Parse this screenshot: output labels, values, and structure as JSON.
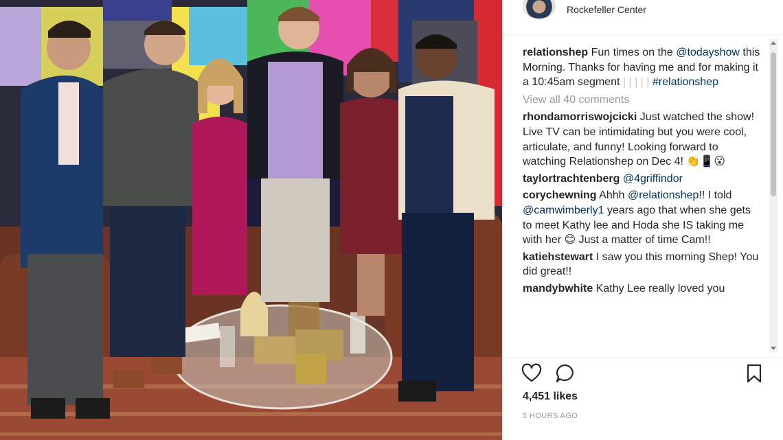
{
  "header": {
    "location": "Rockefeller Center"
  },
  "caption": {
    "user": "relationshep",
    "text_1": " Fun times on the ",
    "mention": "@todayshow",
    "text_2": " this Morning. Thanks for having me and for making it a 10:45am segment ",
    "bars": "| | | | |",
    "hashtag": "#relationshep"
  },
  "view_all": "View all 40 comments",
  "comments": [
    {
      "user": "rhondamorriswojcicki",
      "text": " Just watched the show! Live TV can be intimidating but you were cool, articulate, and funny! Looking forward to watching Relationshep on Dec 4! 👏📱😮"
    },
    {
      "user": "taylortrachtenberg",
      "mention": " @4griffindor"
    },
    {
      "user": "corychewning",
      "text_1": " Ahhh ",
      "mention_1": "@relationshep",
      "text_2": "!! I told ",
      "mention_2": "@camwimberly1",
      "text_3": " years ago that when she gets to meet Kathy lee and Hoda she IS taking me with her 😊 Just a matter of time Cam!!"
    },
    {
      "user": "katiehstewart",
      "text": " I saw you this morning Shep! You did great!!"
    },
    {
      "user": "mandybwhite",
      "text": " Kathy Lee really loved you"
    }
  ],
  "actions": {
    "like_icon": "heart-outline-icon",
    "comment_icon": "speech-bubble-icon",
    "save_icon": "bookmark-icon"
  },
  "likes": "4,451 likes",
  "timestamp": "5 HOURS AGO",
  "colors": {
    "link": "#003569",
    "muted": "#999999",
    "text": "#262626"
  }
}
